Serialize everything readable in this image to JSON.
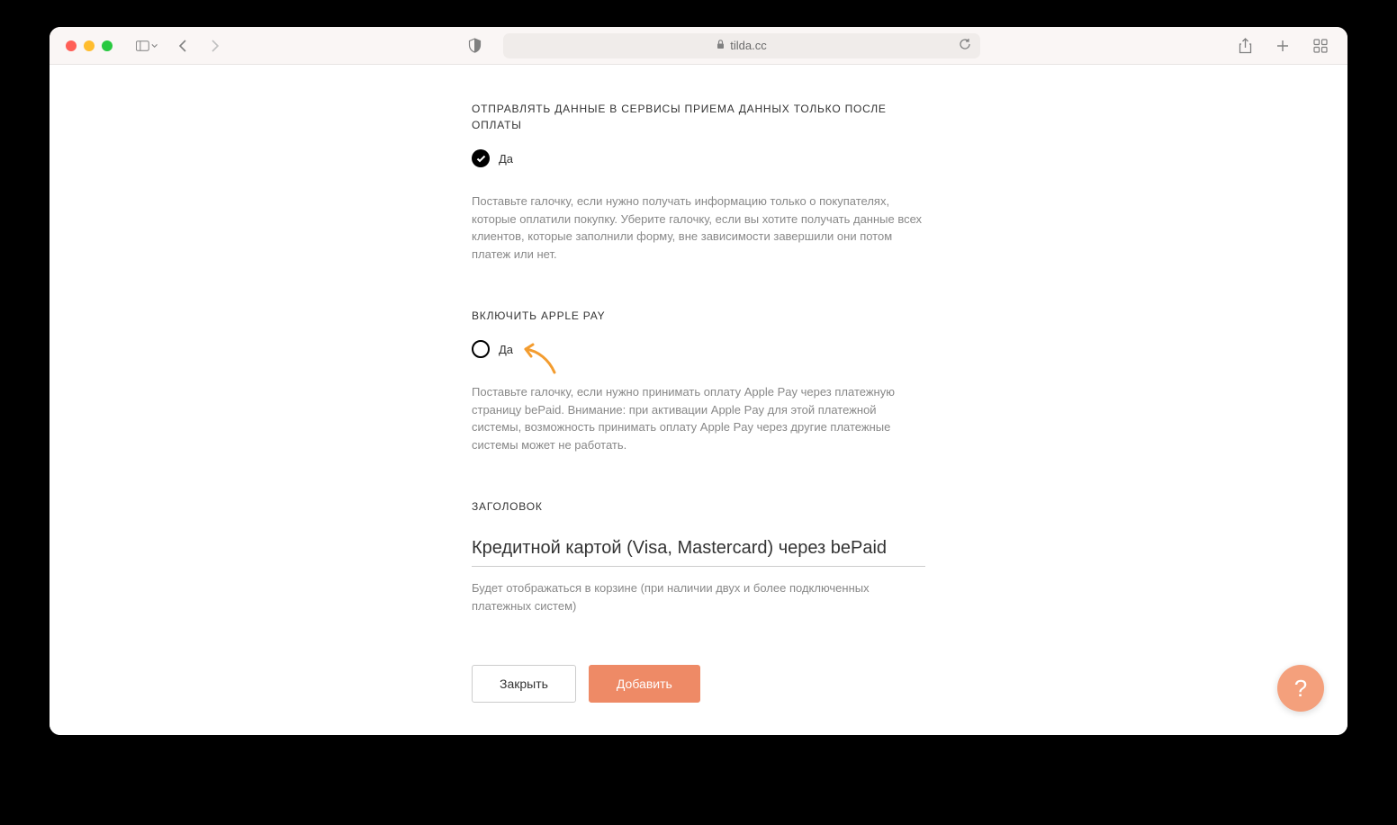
{
  "browser": {
    "url": "tilda.cc"
  },
  "section1": {
    "title": "ОТПРАВЛЯТЬ ДАННЫЕ В СЕРВИСЫ ПРИЕМА ДАННЫХ ТОЛЬКО ПОСЛЕ ОПЛАТЫ",
    "checkbox_label": "Да",
    "description": "Поставьте галочку, если нужно получать информацию только о покупателях, которые оплатили покупку. Уберите галочку, если вы хотите получать данные всех клиентов, которые заполнили форму, вне зависимости завершили они потом платеж или нет."
  },
  "section2": {
    "title": "ВКЛЮЧИТЬ APPLE PAY",
    "checkbox_label": "Да",
    "description": "Поставьте галочку, если нужно принимать оплату Apple Pay через платежную страницу bePaid. Внимание: при активации Apple Pay для этой платежной системы, возможность принимать оплату Apple Pay через другие платежные системы может не работать."
  },
  "section3": {
    "title": "ЗАГОЛОВОК",
    "input_value": "Кредитной картой (Visa, Mastercard) через bePaid",
    "hint": "Будет отображаться в корзине (при наличии двух и более подключенных платежных систем)"
  },
  "buttons": {
    "close": "Закрыть",
    "add": "Добавить"
  },
  "help": {
    "label": "?"
  }
}
